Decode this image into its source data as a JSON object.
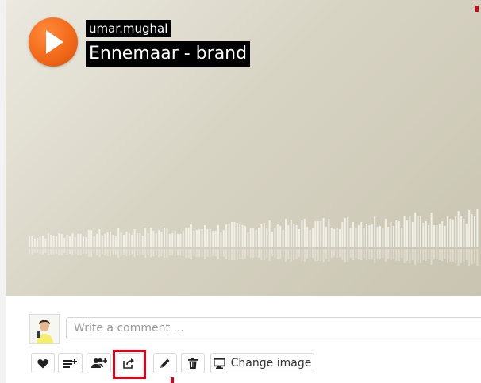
{
  "sound": {
    "uploader": "umar.mughal",
    "title": "Ennemaar - brand"
  },
  "comment": {
    "placeholder": "Write a comment ..."
  },
  "actions": {
    "like_icon": "heart-icon",
    "add_to_playlist_icon": "add-to-playlist-icon",
    "repost_icon": "add-users-icon",
    "share_icon": "share-icon",
    "edit_icon": "pencil-icon",
    "delete_icon": "trash-icon",
    "change_image_label": "Change image",
    "change_image_icon": "monitor-icon"
  },
  "colors": {
    "brand_orange": "#f26a1a",
    "highlight_red": "#e0001a",
    "waveform": "#f3f2ec"
  }
}
